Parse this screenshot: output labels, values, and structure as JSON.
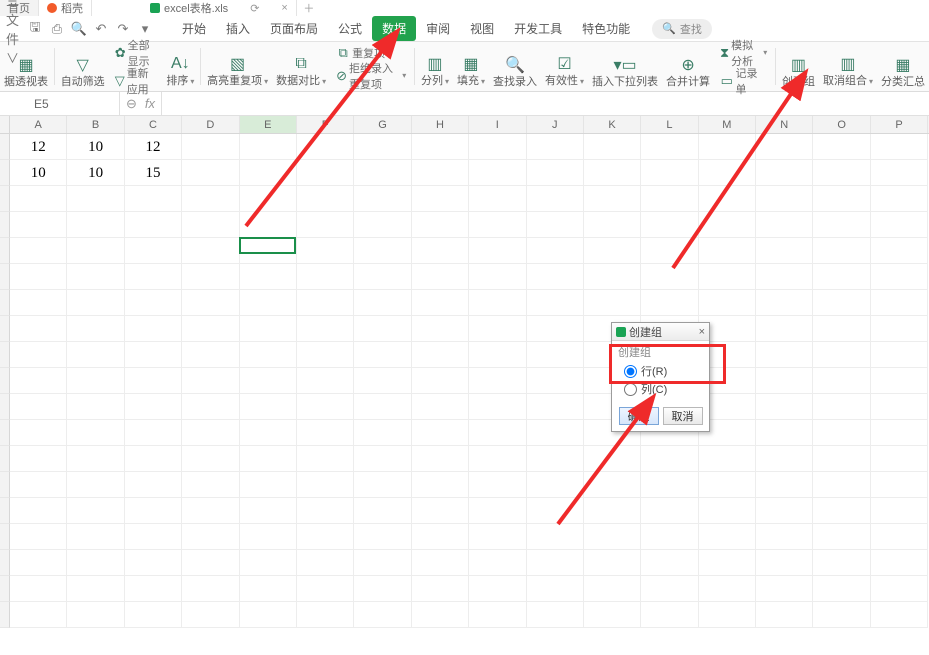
{
  "tabs": {
    "home": "首页",
    "second": "稻壳",
    "file": "excel表格.xls"
  },
  "qat": {
    "file_menu": "三 文件 ∨"
  },
  "menus": {
    "kaishi": "开始",
    "charu": "插入",
    "yemian": "页面布局",
    "gongshi": "公式",
    "shuju": "数据",
    "shenyue": "审阅",
    "shitu": "视图",
    "kaifa": "开发工具",
    "tese": "特色功能"
  },
  "search": "查找",
  "toolbar": {
    "pivot": "据透视表",
    "autofilter": "自动筛选",
    "showall": "全部显示",
    "reapply": "重新应用",
    "sort": "排序",
    "highlight": "高亮重复项",
    "compare": "数据对比",
    "dup_top": "重复项",
    "reject_dup": "拒绝录入重复项",
    "textcol": "分列",
    "fill": "填充",
    "findentry": "查找录入",
    "validity": "有效性",
    "dropdown": "插入下拉列表",
    "merge": "合并计算",
    "whatif": "模拟分析",
    "form": "记录单",
    "group": "创建组",
    "ungroup": "取消组合",
    "subtotal": "分类汇总"
  },
  "namebox": "E5",
  "columns": [
    "A",
    "B",
    "C",
    "D",
    "E",
    "F",
    "G",
    "H",
    "I",
    "J",
    "K",
    "L",
    "M",
    "N",
    "O",
    "P"
  ],
  "cells": {
    "r1": {
      "A": "12",
      "B": "10",
      "C": "12"
    },
    "r2": {
      "A": "10",
      "B": "10",
      "C": "15"
    }
  },
  "dialog": {
    "title": "创建组",
    "group_name": "创建组",
    "opt_row": "行(R)",
    "opt_col": "列(C)",
    "ok": "确定",
    "cancel": "取消"
  }
}
